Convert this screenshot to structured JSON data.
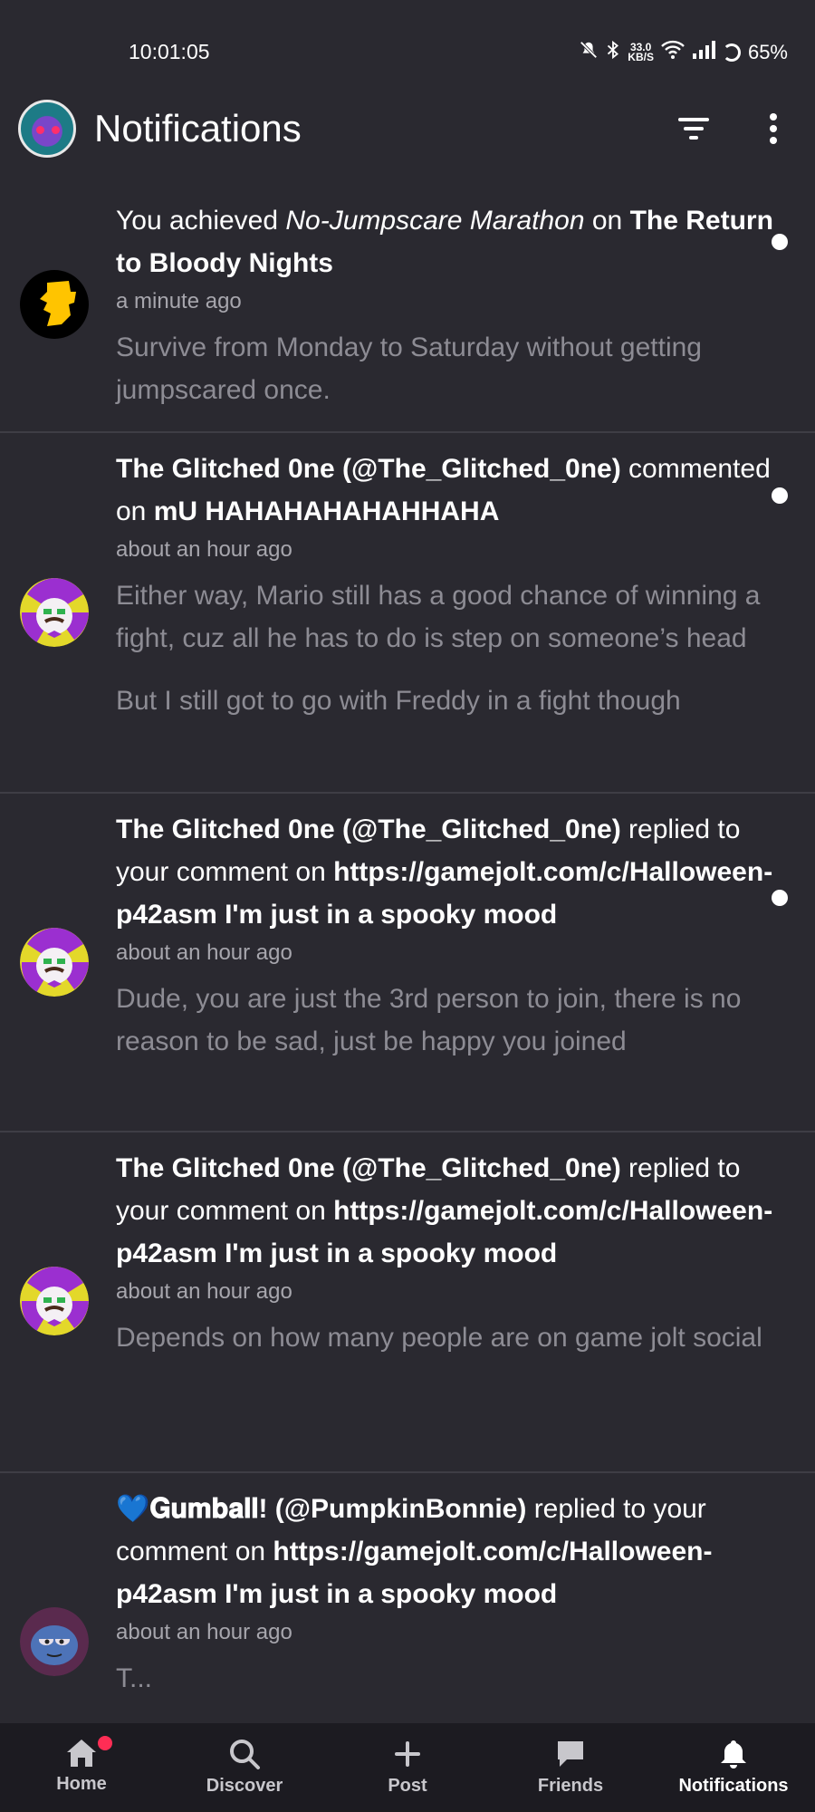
{
  "status_bar": {
    "time": "10:01:05",
    "speed_top": "33.0",
    "speed_bottom": "KB/S",
    "battery": "65%"
  },
  "header": {
    "title": "Notifications"
  },
  "notifications": [
    {
      "prefix": "You achieved ",
      "italic": "No-Jumpscare Marathon",
      "middle": " on ",
      "bold": "The Return to Bloody Nights",
      "time": "a minute ago",
      "body": [
        "Survive from Monday to Saturday without getting jumpscared once."
      ],
      "unread": true
    },
    {
      "user": "The Glitched 0ne (@The_Glitched_0ne)",
      "action": " commented on ",
      "target": "mU HAHAHAHAHAHHAHA",
      "time": "about an hour ago",
      "body": [
        "Either way, Mario still has a good chance of winning a fight, cuz all he has to do is step on someone’s head",
        "But I still got to go with Freddy in a fight though"
      ],
      "unread": true
    },
    {
      "user": "The Glitched 0ne (@The_Glitched_0ne)",
      "action": " replied to your comment on ",
      "target": "https://gamejolt.com/c/Halloween-p42asm I'm just in a spooky mood",
      "time": "about an hour ago",
      "body": [
        "Dude, you are just the 3rd person to join, there is no reason to be sad, just be happy you joined"
      ],
      "unread": true
    },
    {
      "user": "The Glitched 0ne (@The_Glitched_0ne)",
      "action": " replied to your comment on ",
      "target": "https://gamejolt.com/c/Halloween-p42asm I'm just in a spooky mood",
      "time": "about an hour ago",
      "body": [
        "Depends on how many people are on game jolt social"
      ],
      "unread": false
    },
    {
      "user_emoji": "💙",
      "user": "𝐆𝐮𝐦𝐛𝐚𝐥𝐥! (@PumpkinBonnie)",
      "action": " replied to your comment on ",
      "target": "https://gamejolt.com/c/Halloween-p42asm I'm just in a spooky mood",
      "time": "about an hour ago",
      "body": [
        "T..."
      ],
      "unread": false
    }
  ],
  "nav": {
    "home": "Home",
    "discover": "Discover",
    "post": "Post",
    "friends": "Friends",
    "notifications": "Notifications"
  },
  "colors": {
    "background": "#2a2930",
    "nav_background": "#1c1b21",
    "badge": "#ff2d55",
    "muted_text": "#8d8c94"
  }
}
